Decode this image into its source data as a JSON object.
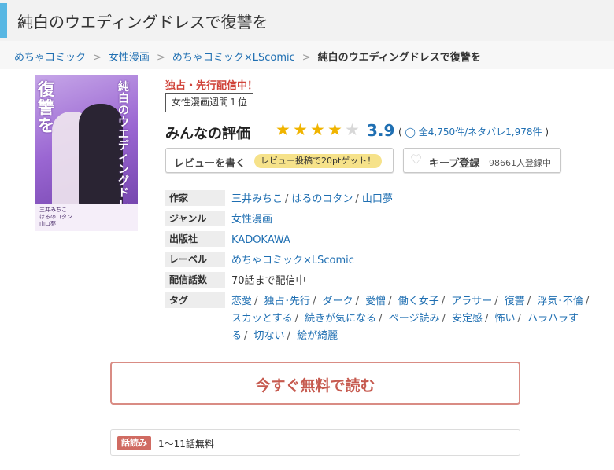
{
  "page": {
    "title": "純白のウエディングドレスで復讐を"
  },
  "breadcrumb": {
    "items": [
      "めちゃコミック",
      "女性漫画",
      "めちゃコミック×LScomic"
    ],
    "current": "純白のウエディングドレスで復讐を",
    "separator": ">"
  },
  "cover": {
    "title_right": "純白のウエディングドレスで",
    "title_left": "復讐を",
    "credits": [
      "三井みちこ",
      "はるのコタン",
      "山口夢"
    ]
  },
  "book": {
    "exclusive": "独占・先行配信中！",
    "rank": "女性漫画週間１位"
  },
  "rating": {
    "label": "みんなの評価",
    "score": "3.9",
    "stars_filled": 4,
    "stars_total": 5,
    "open_paren": "(",
    "counts": "◯ 全4,750件/ネタバレ1,978件",
    "close_paren": ")"
  },
  "review_button": {
    "label": "レビューを書く",
    "promo": "レビュー投稿で20ptゲット！"
  },
  "keep_button": {
    "label": "キープ登録",
    "count": "98661人登録中"
  },
  "details": {
    "author": {
      "key": "作家",
      "values": [
        "三井みちこ",
        "はるのコタン",
        "山口夢"
      ]
    },
    "genre": {
      "key": "ジャンル",
      "value": "女性漫画"
    },
    "publisher": {
      "key": "出版社",
      "value": "KADOKAWA"
    },
    "label": {
      "key": "レーベル",
      "value": "めちゃコミック×LScomic"
    },
    "episodes": {
      "key": "配信話数",
      "value": "70話まで配信中"
    },
    "tags": {
      "key": "タグ",
      "values": [
        "恋愛",
        "独占･先行",
        "ダーク",
        "愛憎",
        "働く女子",
        "アラサー",
        "復讐",
        "浮気･不倫",
        "スカッとする",
        "続きが気になる",
        "ページ読み",
        "安定感",
        "怖い",
        "ハラハラする",
        "切ない",
        "絵が綺麗"
      ]
    }
  },
  "read_button": {
    "label": "今すぐ無料で読む"
  },
  "free_info": {
    "badge": "話読み",
    "text": "1〜11話無料"
  },
  "colors": {
    "accent": "#58b7e3",
    "link": "#1f6fb2",
    "star": "#f0b400",
    "exclusive": "#d0443a",
    "read": "#c65a4f"
  },
  "icons": {
    "heart": "heart-icon",
    "star": "star-icon",
    "comment": "comment-icon"
  }
}
